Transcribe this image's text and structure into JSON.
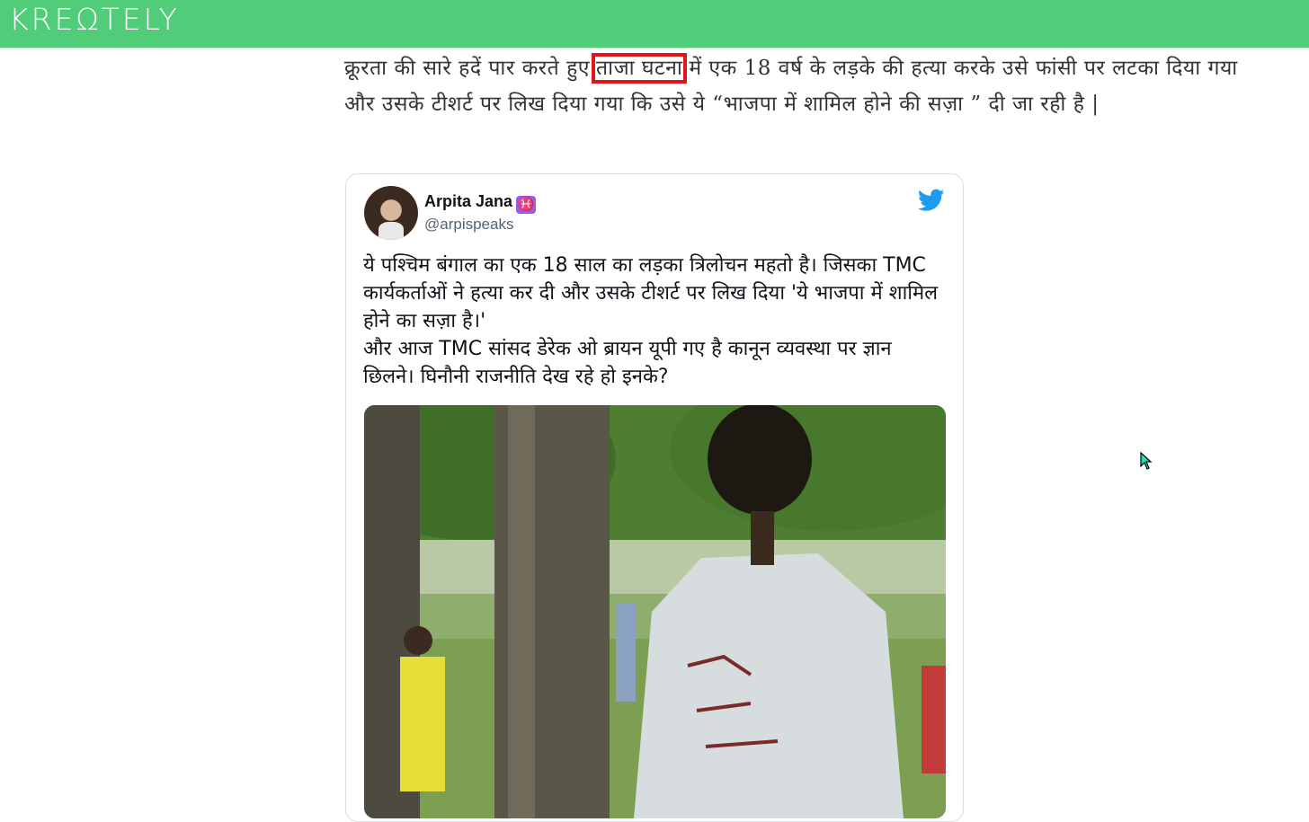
{
  "header": {
    "logo_text": "KREΩTELY",
    "background_color": "#51cc79"
  },
  "article": {
    "line1_before": "क्रूरता की सारे हदें पार करते हुए",
    "highlight": "ताजा घटना",
    "line1_after": "में एक 18 वर्ष के लड़के की हत्या करके उसे फांसी पर लटका दिया गया और उसके टीशर्ट पर लिख दिया गया कि उसे ये “भाजपा में शामिल होने की सज़ा ” दी जा रही है |",
    "highlight_color": "#e0161b"
  },
  "tweet": {
    "author_name": "Arpita Jana",
    "zodiac_icon": "pisces-icon",
    "zodiac_glyph": "♓",
    "handle": "@arpispeaks",
    "text": "ये पश्चिम बंगाल का एक 18 साल का लड़का त्रिलोचन महतो है। जिसका TMC कार्यकर्ताओं ने हत्या कर दी और उसके टीशर्ट पर लिख दिया 'ये भाजपा में शामिल होने का सज़ा है।'\nऔर आज TMC सांसद डेरेक ओ ब्रायन यूपी गए है कानून व्यवस्था पर ज्ञान छिलने। घिनौनी राजनीति देख रहे हो इनके?",
    "brand_icon": "twitter-bird-icon",
    "brand_color": "#1d9bf0"
  }
}
